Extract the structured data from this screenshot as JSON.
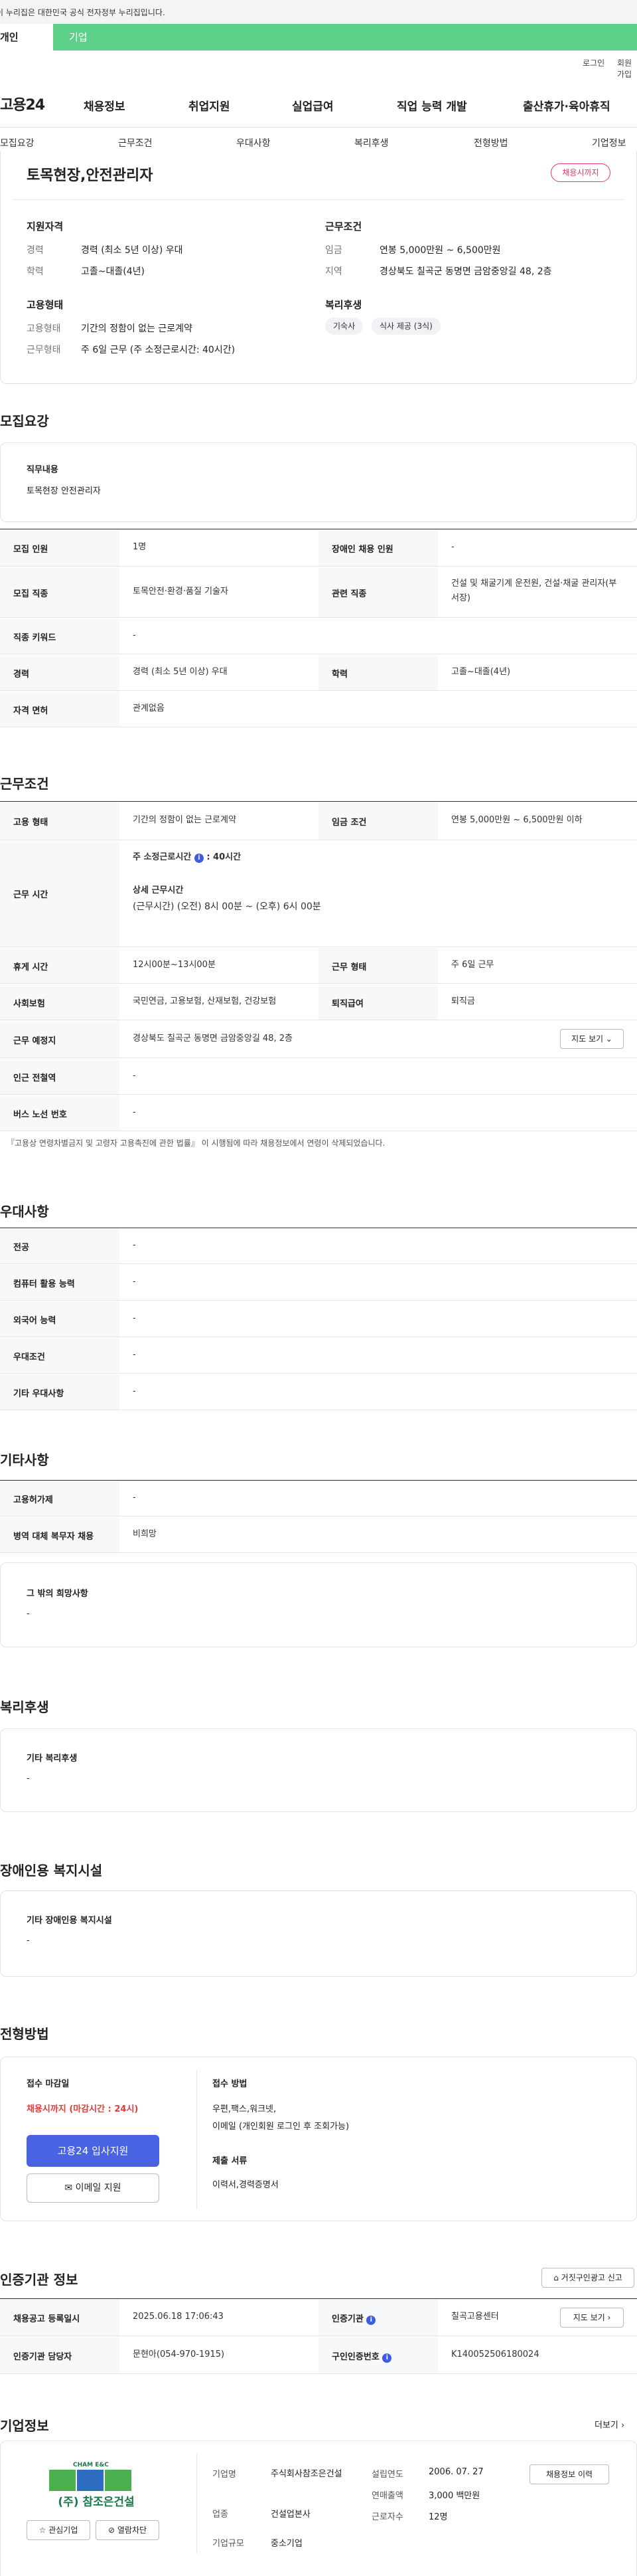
{
  "gov_notice": "이 누리집은 대한민국 공식 전자정부 누리집입니다.",
  "user_tabs": {
    "individual": "개인",
    "corporate": "기업"
  },
  "util_links": {
    "login": "로그인",
    "signup": "회원가입"
  },
  "gnb": {
    "logo": "고용24",
    "items": [
      "채용정보",
      "취업지원",
      "실업급여",
      "직업 능력 개발",
      "출산휴가·육아휴직"
    ]
  },
  "subnav": [
    "모집요강",
    "근무조건",
    "우대사항",
    "복리후생",
    "전형방법",
    "기업정보"
  ],
  "summary": {
    "title": "토목현장,안전관리자",
    "badge": "채용시까지",
    "qual_heading": "지원자격",
    "career_k": "경력",
    "career_v": "경력 (최소 5년 이상) 우대",
    "edu_k": "학력",
    "edu_v": "고졸~대졸(4년)",
    "emp_heading": "고용형태",
    "emptype_k": "고용형태",
    "emptype_v": "기간의 정함이 없는 근로계약",
    "worktype_k": "근무형태",
    "worktype_v": "주 6일 근무 (주 소정근로시간: 40시간)",
    "cond_heading": "근무조건",
    "wage_k": "임금",
    "wage_v": "연봉 5,000만원 ~ 6,500만원",
    "region_k": "지역",
    "region_v": "경상북도 칠곡군 동명면 금암중앙길 48, 2층",
    "welfare_heading": "복리후생",
    "chips": [
      "기숙사",
      "식사 제공 (3식)"
    ]
  },
  "recruit": {
    "title": "모집요강",
    "duty_k": "직무내용",
    "duty_v": "토목현장 안전관리자",
    "rows": [
      {
        "k1": "모집 인원",
        "v1": "1명",
        "k2": "장애인 채용 인원",
        "v2": "-"
      },
      {
        "k1": "모집 직종",
        "v1": "토목안전·환경·품질 기술자",
        "k2": "관련 직종",
        "v2": "건설 및 채굴기계 운전원, 건설·채굴 관리자(부서장)"
      },
      {
        "k1": "직종 키워드",
        "v1": "-"
      },
      {
        "k1": "경력",
        "v1": "경력 (최소 5년 이상) 우대",
        "k2": "학력",
        "v2": "고졸~대졸(4년)"
      },
      {
        "k1": "자격 면허",
        "v1": "관계없음"
      }
    ]
  },
  "work": {
    "title": "근무조건",
    "emp_k": "고용 형태",
    "emp_v": "기간의 정함이 없는 근로계약",
    "wage_k": "임금 조건",
    "wage_v": "연봉 5,000만원 ~ 6,500만원 이하",
    "hours_k": "근무 시간",
    "hours_weekly": "주 소정근로시간",
    "hours_weekly_val": ": 40시간",
    "hours_detail_label": "상세 근무시간",
    "hours_detail": "(근무시간) (오전) 8시 00분 ~ (오후) 6시 00분",
    "break_k": "휴게 시간",
    "break_v": "12시00분~13시00분",
    "form_k": "근무 형태",
    "form_v": "주 6일 근무",
    "ins_k": "사회보험",
    "ins_v": "국민연금, 고용보험, 산재보험, 건강보험",
    "ret_k": "퇴직급여",
    "ret_v": "퇴직금",
    "loc_k": "근무 예정지",
    "loc_v": "경상북도 칠곡군 동명면 금암중앙길 48, 2층",
    "map_btn": "지도 보기",
    "subway_k": "인근 전철역",
    "subway_v": "-",
    "bus_k": "버스 노선 번호",
    "bus_v": "-",
    "note": "『고용상 연령차별금지 및 고령자 고용촉진에 관한 법률』 이 시행됨에 따라 채용정보에서 연령이 삭제되었습니다."
  },
  "pref": {
    "title": "우대사항",
    "rows": [
      {
        "k": "전공",
        "v": "-"
      },
      {
        "k": "컴퓨터 활용 능력",
        "v": "-"
      },
      {
        "k": "외국어 능력",
        "v": "-"
      },
      {
        "k": "우대조건",
        "v": "-"
      },
      {
        "k": "기타 우대사항",
        "v": "-"
      }
    ]
  },
  "other": {
    "title": "기타사항",
    "rows": [
      {
        "k": "고용허가제",
        "v": "-"
      },
      {
        "k": "병역 대체 복무자 채용",
        "v": "비희망"
      }
    ],
    "box_k": "그 밖의 희망사항",
    "box_v": "-"
  },
  "welfare": {
    "title": "복리후생",
    "box_k": "기타 복리후생",
    "box_v": "-"
  },
  "disability": {
    "title": "장애인용 복지시설",
    "box_k": "기타 장애인용 복지시설",
    "box_v": "-"
  },
  "selection": {
    "title": "전형방법",
    "deadline_k": "접수 마감일",
    "deadline_v": "채용시까지 (마감시간 : 24시)",
    "apply_btn": "고용24 입사지원",
    "email_btn": "이메일 지원",
    "method_k": "접수 방법",
    "method_v1": "우편,팩스,워크넷,",
    "method_v2": "이메일 (개인회원 로그인 후 조회가능)",
    "docs_k": "제출 서류",
    "docs_v": "이력서,경력증명서"
  },
  "cert": {
    "title": "인증기관 정보",
    "report_btn": "거짓구인광고 신고",
    "reg_k": "채용공고 등록일시",
    "reg_v": "2025.06.18 17:06:43",
    "org_k": "인증기관",
    "org_v": "칠곡고용센터",
    "detail_btn": "지도 보기",
    "mgr_k": "인증기관 담당자",
    "mgr_v": "문현아(054-970-1915)",
    "num_k": "구인인증번호",
    "num_v": "K140052506180024"
  },
  "company": {
    "title": "기업정보",
    "more": "더보기",
    "logo_text": "(주) 참조은건설",
    "logo_en": "CHAM E&C",
    "fav_btn": "관심기업",
    "block_btn": "열람차단",
    "name_k": "기업명",
    "name_v": "주식회사참조은건설",
    "ind_k": "업종",
    "ind_v": "건설업본사",
    "size_k": "기업규모",
    "size_v": "중소기업",
    "est_k": "설립연도",
    "est_v": "2006. 07. 27",
    "sales_k": "연매출액",
    "sales_v": "3,000 백만원",
    "emp_k": "근로자수",
    "emp_v": "12명",
    "hist_btn": "채용정보 이력"
  },
  "colors": {
    "accent_green": "#5dd08a",
    "accent_blue": "#4a63e3",
    "badge_red": "#e43a6b"
  }
}
